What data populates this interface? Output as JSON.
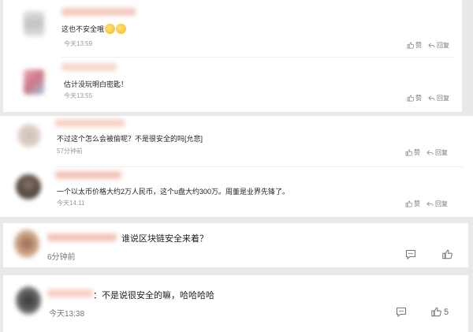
{
  "actions": {
    "like": "赞",
    "reply": "回复"
  },
  "comments": [
    {
      "text": "这也不安全哦",
      "time": "今天13:59"
    },
    {
      "text": "估计没玩明白密匙！",
      "time": "今天13:55"
    },
    {
      "text": "不过这个怎么会被偷呢？不是很安全的吗[允悲]",
      "time": "57分钟前"
    },
    {
      "text": "一个以太币价格大约2万人民币，这个u盘大约300万。周董是业界先锋了。",
      "time": "今天14:11"
    },
    {
      "text": "谁说区块链安全来着？",
      "time": "6分钟前"
    },
    {
      "text": "：不是说很安全的嘛，哈哈哈哈",
      "time": "今天13:38",
      "like_count": "5"
    }
  ],
  "icons": {
    "like": "thumbs-up-icon",
    "reply": "reply-arrow-icon",
    "comment": "comment-bubble-icon",
    "emoji": "laughing-face-emoji"
  },
  "colors": {
    "background": "#e9e9e9",
    "card": "#ffffff",
    "time": "#999999",
    "action": "#777777"
  }
}
